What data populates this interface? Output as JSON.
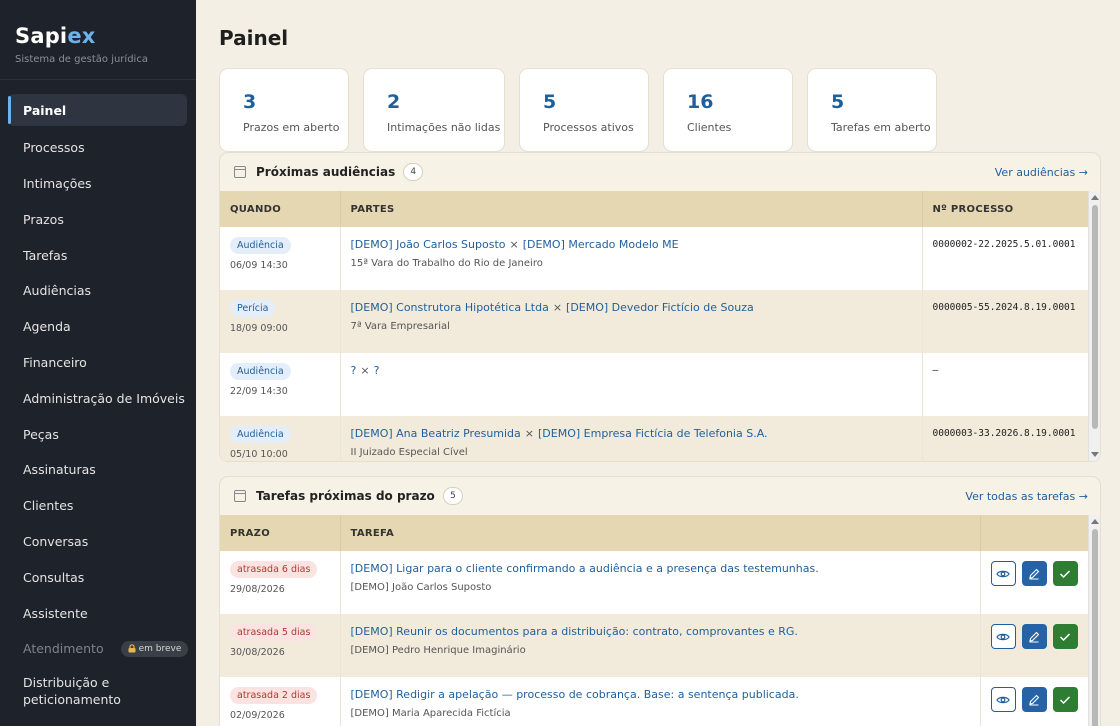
{
  "brand": {
    "name_main": "Sapi",
    "name_accent": "ex",
    "subtitle": "Sistema de gestão jurídica"
  },
  "sidebar": {
    "items": [
      {
        "label": "Painel"
      },
      {
        "label": "Processos"
      },
      {
        "label": "Intimações"
      },
      {
        "label": "Prazos"
      },
      {
        "label": "Tarefas"
      },
      {
        "label": "Audiências"
      },
      {
        "label": "Agenda"
      },
      {
        "label": "Financeiro"
      },
      {
        "label": "Administração de Imóveis"
      },
      {
        "label": "Peças"
      },
      {
        "label": "Assinaturas"
      },
      {
        "label": "Clientes"
      },
      {
        "label": "Conversas"
      },
      {
        "label": "Consultas"
      },
      {
        "label": "Assistente"
      },
      {
        "label": "Atendimento",
        "badge": "em breve"
      },
      {
        "label_line1": "Distribuição e",
        "label_line2": "peticionamento"
      }
    ]
  },
  "page": {
    "title": "Painel"
  },
  "stats": [
    {
      "value": "3",
      "label": "Prazos em aberto"
    },
    {
      "value": "2",
      "label": "Intimações não lidas"
    },
    {
      "value": "5",
      "label": "Processos ativos"
    },
    {
      "value": "16",
      "label": "Clientes"
    },
    {
      "value": "5",
      "label": "Tarefas em aberto"
    }
  ],
  "hearings": {
    "title": "Próximas audiências",
    "count": "4",
    "link": "Ver audiências →",
    "columns": {
      "when": "QUANDO",
      "parties": "PARTES",
      "process": "Nº PROCESSO"
    },
    "rows": [
      {
        "type": "Audiência",
        "date": "06/09 14:30",
        "party_a": "[DEMO] João Carlos Suposto",
        "sep": "×",
        "party_b": "[DEMO] Mercado Modelo ME",
        "court": "15ª Vara do Trabalho do Rio de Janeiro",
        "process": "0000002-22.2025.5.01.0001"
      },
      {
        "type": "Perícia",
        "date": "18/09 09:00",
        "party_a": "[DEMO] Construtora Hipotética Ltda",
        "sep": "×",
        "party_b": "[DEMO] Devedor Fictício de Souza",
        "court": "7ª Vara Empresarial",
        "process": "0000005-55.2024.8.19.0001"
      },
      {
        "type": "Audiência",
        "date": "22/09 14:30",
        "party_a": "?",
        "sep": "×",
        "party_b": "?",
        "court": "",
        "process": "—"
      },
      {
        "type": "Audiência",
        "date": "05/10 10:00",
        "party_a": "[DEMO] Ana Beatriz Presumida",
        "sep": "×",
        "party_b": "[DEMO] Empresa Fictícia de Telefonia S.A.",
        "court": "II Juizado Especial Cível",
        "process": "0000003-33.2026.8.19.0001"
      }
    ]
  },
  "tasks": {
    "title": "Tarefas próximas do prazo",
    "count": "5",
    "link": "Ver todas as tarefas →",
    "columns": {
      "deadline": "PRAZO",
      "task": "TAREFA"
    },
    "rows": [
      {
        "late": "atrasada 6 dias",
        "date": "29/08/2026",
        "task": "[DEMO] Ligar para o cliente confirmando a audiência e a presença das testemunhas.",
        "client": "[DEMO] João Carlos Suposto"
      },
      {
        "late": "atrasada 5 dias",
        "date": "30/08/2026",
        "task": "[DEMO] Reunir os documentos para a distribuição: contrato, comprovantes e RG.",
        "client": "[DEMO] Pedro Henrique Imaginário"
      },
      {
        "late": "atrasada 2 dias",
        "date": "02/09/2026",
        "task": "[DEMO] Redigir a apelação — processo de cobrança. Base: a sentença publicada.",
        "client": "[DEMO] Maria Aparecida Fictícia"
      }
    ]
  },
  "icons": {
    "calendar": "calendar-icon",
    "task": "clipboard-check-icon",
    "view": "eye-icon",
    "edit": "pencil-icon",
    "done": "check-icon",
    "lock": "lock-icon"
  },
  "colors": {
    "accent": "#1f5f9c",
    "sidebar_bg": "#1e222a",
    "header_bg": "#e4d7b1",
    "late": "#b03a2e",
    "done": "#2e7d32"
  }
}
